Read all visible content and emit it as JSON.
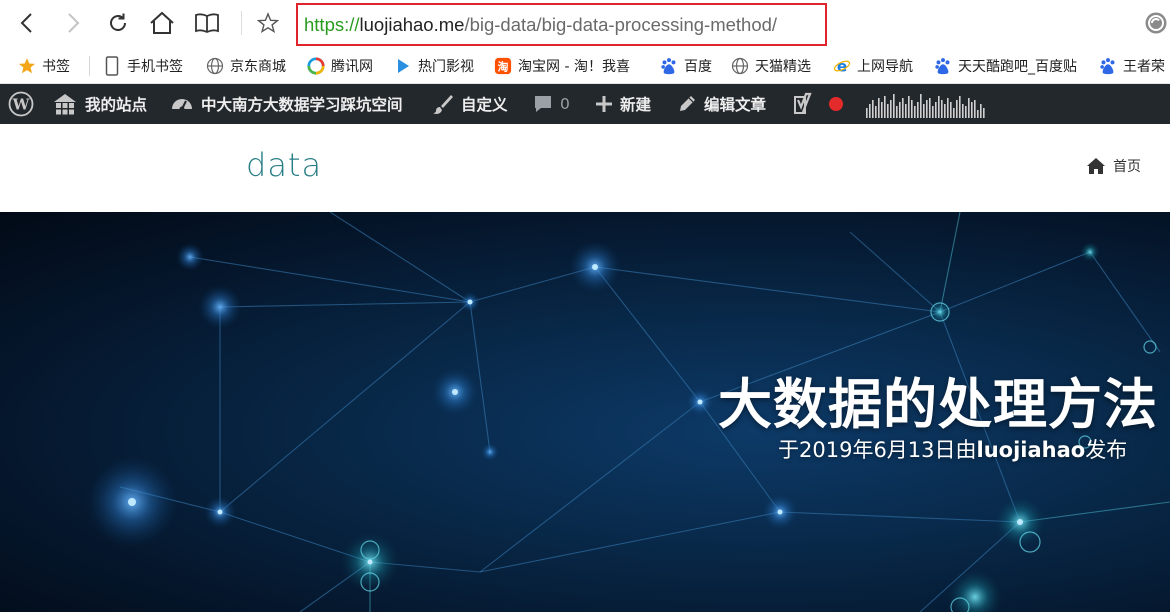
{
  "browser": {
    "url": {
      "scheme": "https://",
      "host": "luojiahao.me",
      "path": "/big-data/big-data-processing-method/"
    }
  },
  "bookmarks": [
    {
      "label": "书签",
      "icon": "star-icon"
    },
    {
      "label": "手机书签",
      "icon": "phone-icon"
    },
    {
      "label": "京东商城",
      "icon": "globe-icon"
    },
    {
      "label": "腾讯网",
      "icon": "tencent-icon"
    },
    {
      "label": "热门影视",
      "icon": "play-icon"
    },
    {
      "label": "淘宝网 - 淘！我喜",
      "icon": "taobao-icon"
    },
    {
      "label": "百度",
      "icon": "baidu-icon"
    },
    {
      "label": "天猫精选",
      "icon": "globe-icon"
    },
    {
      "label": "上网导航",
      "icon": "ie-icon"
    },
    {
      "label": "天天酷跑吧_百度贴",
      "icon": "baidu-icon"
    },
    {
      "label": "王者荣",
      "icon": "baidu-icon"
    }
  ],
  "adminbar": {
    "my_sites": "我的站点",
    "site_name": "中大南方大数据学习踩坑空间",
    "customize": "自定义",
    "comments_count": "0",
    "new": "新建",
    "edit_post": "编辑文章"
  },
  "site": {
    "logo": "data",
    "nav_home": "首页"
  },
  "post": {
    "title": "大数据的处理方法",
    "meta_prefix": "于2019年6月13日由",
    "author": "luojiahao",
    "meta_suffix": "发布"
  },
  "colors": {
    "accent_logo": "#2a7f86",
    "url_border": "#e0242c",
    "url_scheme": "#2a9c1f",
    "adminbar_bg": "#23282d",
    "hero_bg": "#082848"
  }
}
